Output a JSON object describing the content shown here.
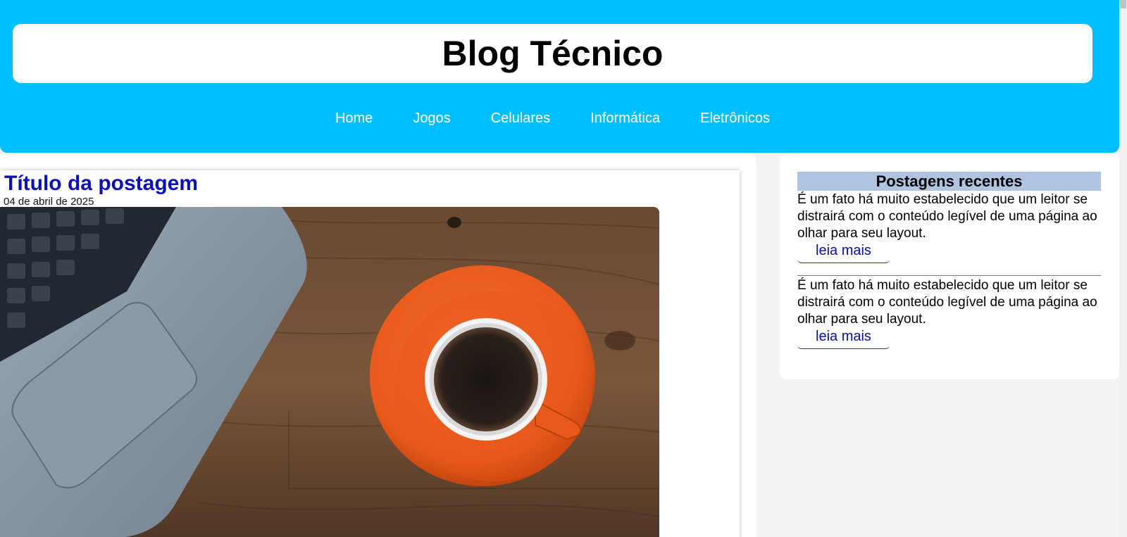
{
  "header": {
    "site_title": "Blog Técnico",
    "nav": [
      "Home",
      "Jogos",
      "Celulares",
      "Informática",
      "Eletrônicos"
    ]
  },
  "post": {
    "title": "Título da postagem",
    "date": "04 de abril de 2025",
    "image_subject": "laptop-and-coffee-cup-photo"
  },
  "sidebar": {
    "heading": "Postagens recentes",
    "items": [
      {
        "text": "É um fato há muito estabelecido que um leitor se distrairá com o conteúdo legível de uma página ao olhar para seu layout.",
        "link": "leia mais"
      },
      {
        "text": "É um fato há muito estabelecido que um leitor se distrairá com o conteúdo legível de uma página ao olhar para seu layout.",
        "link": "leia mais"
      }
    ]
  },
  "colors": {
    "header_bg": "#00bfff",
    "post_title": "#0a10b7",
    "sidebar_heading_bg": "#aec4e0",
    "link": "#0a10a0"
  }
}
